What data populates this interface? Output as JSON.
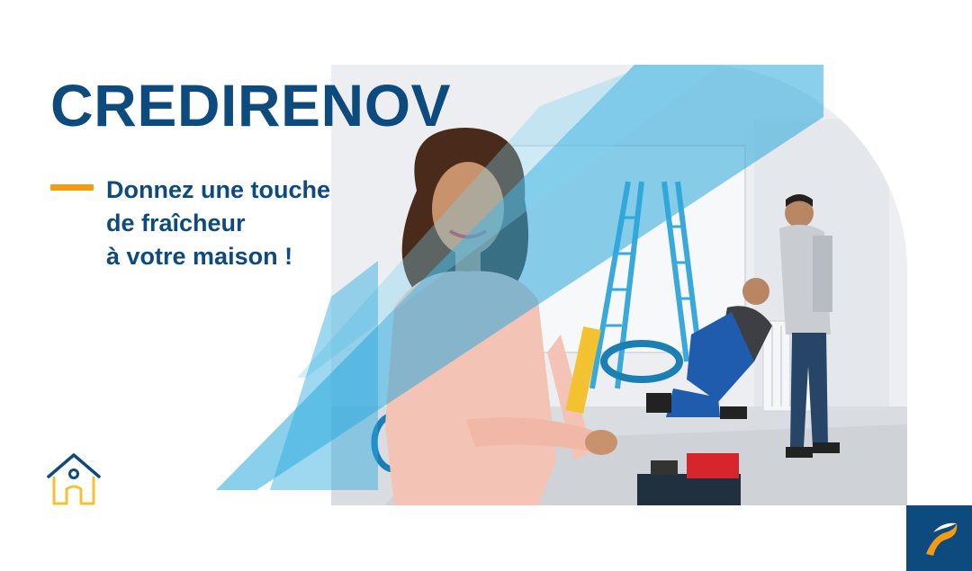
{
  "banner": {
    "title": "CREDIRENOV",
    "tagline_lines": [
      "Donnez une touche",
      "de fraîcheur",
      "à votre maison !"
    ]
  },
  "icons": {
    "home": "house-icon",
    "brand": "bank-logo-icon"
  },
  "colors": {
    "brand_blue": "#0d4a7d",
    "accent_orange": "#f39c12",
    "ribbon_blue": "#29a8dd",
    "house_yellow": "#f2c230"
  }
}
